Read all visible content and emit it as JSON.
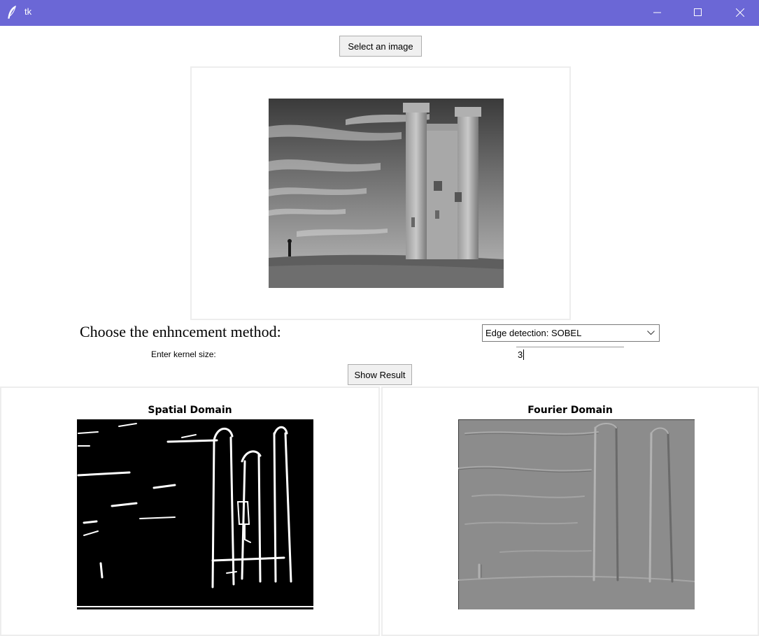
{
  "window": {
    "title": "tk",
    "icon": "feather-icon",
    "accent_color": "#6b67d6"
  },
  "controls": {
    "select_image_label": "Select an image",
    "method_label": "Choose the enhncement method:",
    "method_selected": "Edge detection: SOBEL",
    "kernel_label": "Enter kernel size:",
    "kernel_value": "3",
    "show_result_label": "Show Result"
  },
  "results": {
    "spatial_title": "Spatial Domain",
    "fourier_title": "Fourier Domain"
  }
}
